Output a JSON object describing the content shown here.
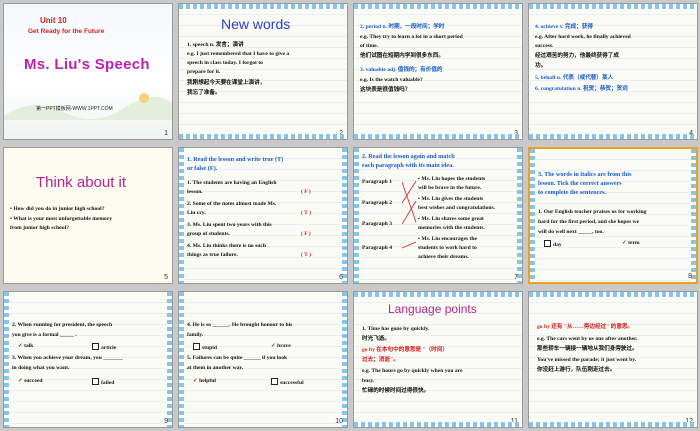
{
  "slides": [
    {
      "num": "1",
      "unit": "Unit 10",
      "subtitle": "Get Ready for the Future",
      "title": "Ms. Liu's Speech",
      "footer": "第一PPT模板网-WWW.1PPT.COM"
    },
    {
      "num": "2",
      "heading": "New words",
      "lines": [
        "1. speech   n.  发言；演讲",
        "   e.g. I just remembered that I have to give a",
        "   speech in class today.  I forgot to",
        "   prepare for it.",
        "   我刚想起今天要在课堂上演讲，",
        "   我忘了准备。"
      ]
    },
    {
      "num": "3",
      "lines": [
        "2. period    n.    时期，一段时间；学时",
        "   e.g.  They try to learn a lot in a short period",
        "   of time.",
        "   他们试图在短期内学到很多东西。",
        "3. valuable     adj.  值钱的；有价值的",
        "   e.g.  Is the watch valuable?",
        "   这块表是很值钱吗？"
      ]
    },
    {
      "num": "4",
      "lines": [
        "4. achieve    v.    完成；获得",
        "   e.g.  After hard work, he finally achieved",
        "   success.",
        "   经过艰苦的努力，他最终获得了成",
        "   功。",
        "5. behalf   n. 代表（或代替）某人",
        "6. congratulation   n.  祝贺；恭贺；贺词"
      ]
    },
    {
      "num": "5",
      "heading": "Think about it",
      "lines": [
        "• How did you do in junior high school?",
        "• What is your most unforgettable memory",
        "  from junior high school?"
      ]
    },
    {
      "num": "6",
      "heading": "1. Read the lesson  and write true (T)",
      "heading2": "   or false (F).",
      "items": [
        {
          "text": "1. The students are having an English",
          "text2": "   lesson.",
          "ans": "( F )"
        },
        {
          "text": "2. Some of the notes almost made  Ms.",
          "text2": "   Liu cry.",
          "ans": "( T )"
        },
        {
          "text": "3. Ms. Liu spent two years with this",
          "text2": "   group of students.",
          "ans": "( F )"
        },
        {
          "text": "4. Ms. Liu thinks there is no such",
          "text2": "   things as true failure.",
          "ans": "( T )"
        }
      ]
    },
    {
      "num": "7",
      "heading": "2. Read the lesson  again and match",
      "heading2": "   each paragraph with its main idea.",
      "paras": [
        "Paragraph  1",
        "Paragraph  2",
        "Paragraph  3",
        "Paragraph  4"
      ],
      "ideas": [
        "• Ms. Liu hopes the students",
        "   will be brave  in the future.",
        "• Ms. Liu gives the students",
        "   best wishes and congratulations.",
        "• Ms. Liu shares some great",
        "   memories with the students.",
        "• Ms. Liu encourages the",
        "   students to work hard to",
        "   achieve their dreams."
      ]
    },
    {
      "num": "8",
      "heading": "3. The words  in italics are from this",
      "heading2": "   lesson.  Tick  the correct answers",
      "heading3": "   to complete the sentences.",
      "q1": "1. Our English teacher praises us for working",
      "q1b": "   hard  for the first period,  and  she hopes we",
      "q1c": "   will do well next _____, too.",
      "opt_a": "day",
      "opt_b": "term",
      "tick": "✓"
    },
    {
      "num": "9",
      "q2": "2. When running for president, the speech",
      "q2b": "   you give is a formal _____ .",
      "opt_a": "talk",
      "opt_b": "article",
      "q3": "3. When you achieve your dream, you _______",
      "q3b": "   in doing what you want.",
      "opt_c": "succeed",
      "opt_d": "failed",
      "tick": "✓"
    },
    {
      "num": "10",
      "q4": "4. He is so ______. He brought honour to his",
      "q4b": "   family.",
      "opt_a": "stupid",
      "opt_b": "brave",
      "q5": "5. Failures can be quite ______ if you look",
      "q5b": "   at them in another way.",
      "opt_c": "helpful",
      "opt_d": "successful",
      "tick": "✓"
    },
    {
      "num": "11",
      "heading": "Language points",
      "lines": [
        "1. Time has gone by quickly.",
        "   时光飞逝。",
        "   go by 在本句中的意思是 \"（时间）",
        "   过去；消逝\"。",
        "   e.g. The hours go by quickly when you are",
        "   busy.",
        "   忙碌的时候时间过得很快。"
      ]
    },
    {
      "num": "12",
      "lines": [
        "go by 还有 \"从……旁边经过\" 的意思。",
        "e.g. The cars went by us one after another.",
        "    那些轿车一辆接一辆地从我们身旁驶过。",
        "    You've missed the parade; it just went by.",
        "    你没赶上游行，队伍刚走过去。"
      ]
    }
  ]
}
